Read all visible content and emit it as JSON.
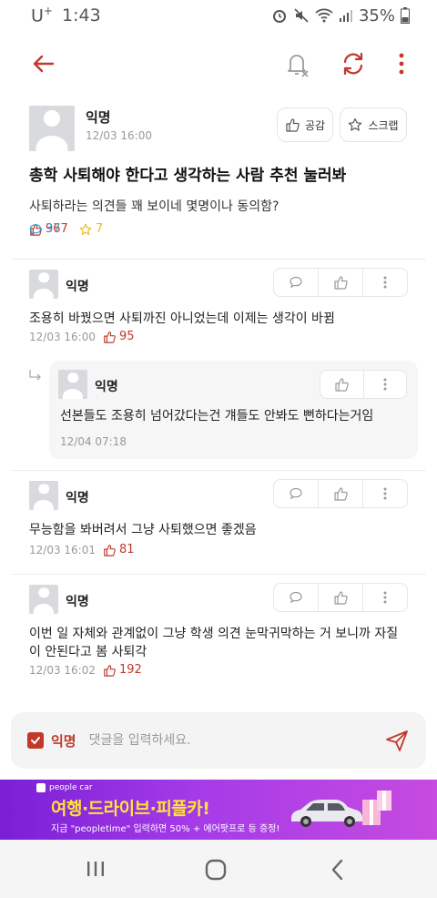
{
  "status_bar": {
    "carrier": "U",
    "carrier_sup": "+",
    "time": "1:43",
    "battery": "35%"
  },
  "post": {
    "author": "익명",
    "time": "12/03 16:00",
    "like_button": "공감",
    "scrap_button": "스크랩",
    "title": "총학 사퇴해야 한다고 생각하는 사람 추천 눌러봐",
    "body": "사퇴하라는 의견들 꽤 보이네 몇명이나 동의함?",
    "likes": "967",
    "comments": "37",
    "scraps": "7"
  },
  "comments": [
    {
      "author": "익명",
      "text": "조용히 바꿨으면 사퇴까진 아니었는데 이제는 생각이 바뀜",
      "time": "12/03 16:00",
      "likes": "95"
    },
    {
      "author": "익명",
      "text": "무능함을 봐버려서 그냥 사퇴했으면 좋겠음",
      "time": "12/03 16:01",
      "likes": "81"
    },
    {
      "author": "익명",
      "text": "이번 일 자체와 관계없이 그냥 학생 의견 눈막귀막하는 거 보니까 자질이 안된다고 봄 사퇴각",
      "time": "12/03 16:02",
      "likes": "192"
    }
  ],
  "reply": {
    "author": "익명",
    "text": "선본들도 조용히 넘어갔다는건 걔들도 안봐도 뻔하다는거임",
    "time": "12/04 07:18"
  },
  "compose": {
    "anonymous_label": "익명",
    "placeholder": "댓글을 입력하세요."
  },
  "ad": {
    "brand": "people car",
    "headline": "여행·드라이브·피플카!",
    "subtext": "지금 \"peopletime\" 입력하면 50% + 에어팟프로 등 증정!"
  },
  "colors": {
    "accent": "#c0392b",
    "comment_blue": "#2f9bd6",
    "scrap_yellow": "#e8b923"
  },
  "icons": [
    "back-arrow-icon",
    "bell-off-icon",
    "refresh-icon",
    "more-vert-icon",
    "thumbs-up-icon",
    "star-icon",
    "speech-bubble-icon",
    "reply-arrow-icon",
    "send-icon",
    "recent-apps-icon",
    "home-icon",
    "back-icon"
  ]
}
